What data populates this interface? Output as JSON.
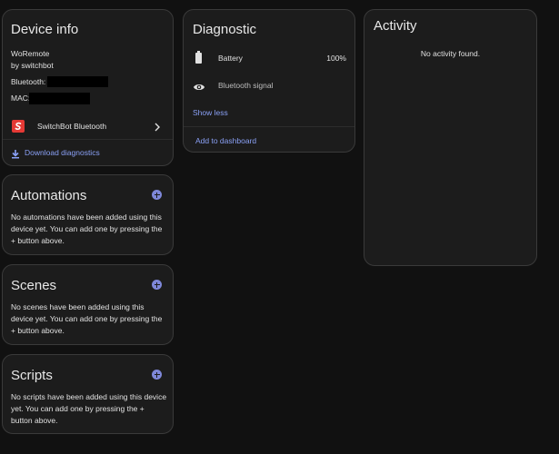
{
  "device_info": {
    "title": "Device info",
    "model": "WoRemote",
    "manufacturer": "by switchbot",
    "bluetooth_label": "Bluetooth:",
    "mac_label": "MAC:",
    "integration_label": "SwitchBot Bluetooth",
    "download_label": "Download diagnostics"
  },
  "automations": {
    "title": "Automations",
    "empty_text": "No automations have been added using this device yet. You can add one by pressing the + button above."
  },
  "scenes": {
    "title": "Scenes",
    "empty_text": "No scenes have been added using this device yet. You can add one by pressing the + button above."
  },
  "scripts": {
    "title": "Scripts",
    "empty_text": "No scripts have been added using this device yet. You can add one by pressing the + button above."
  },
  "diagnostic": {
    "title": "Diagnostic",
    "battery_label": "Battery",
    "battery_value": "100%",
    "signal_label": "Bluetooth signal",
    "show_less": "Show less",
    "add_to_dashboard": "Add to dashboard"
  },
  "activity": {
    "title": "Activity",
    "empty_text": "No activity found."
  },
  "colors": {
    "accent": "#8aa0f5",
    "plus": "#7e87d8",
    "brand_red": "#e53935",
    "card_bg": "#1c1c1c",
    "page_bg": "#111111"
  },
  "icons": {
    "battery": "battery-icon",
    "signal": "eye-icon",
    "download": "download-icon",
    "brand": "switchbot-logo-icon",
    "chevron": "chevron-right-icon",
    "add": "plus-circle-icon"
  }
}
